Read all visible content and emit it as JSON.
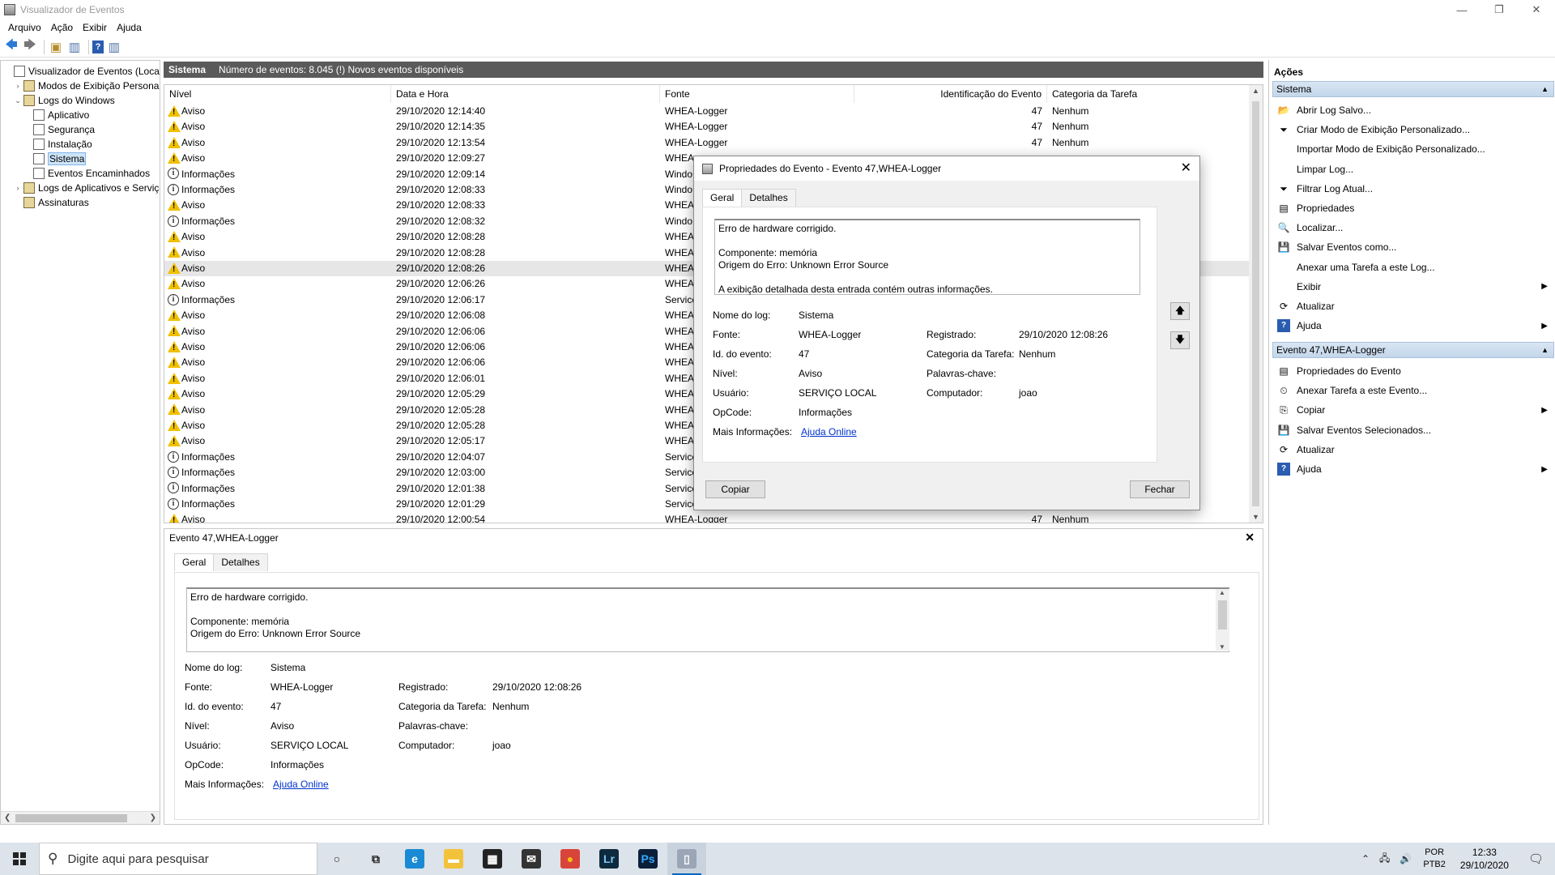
{
  "window": {
    "title": "Visualizador de Eventos",
    "minimize": "—",
    "restore": "❐",
    "close": "✕"
  },
  "menu": [
    "Arquivo",
    "Ação",
    "Exibir",
    "Ajuda"
  ],
  "tree": {
    "items": [
      {
        "label": "Visualizador de Eventos (Local)",
        "level": 0,
        "expander": "",
        "icon": "log"
      },
      {
        "label": "Modos de Exibição Personali",
        "level": 1,
        "expander": "›",
        "icon": "folder"
      },
      {
        "label": "Logs do Windows",
        "level": 1,
        "expander": "⌄",
        "icon": "folder"
      },
      {
        "label": "Aplicativo",
        "level": 2,
        "expander": "",
        "icon": "log"
      },
      {
        "label": "Segurança",
        "level": 2,
        "expander": "",
        "icon": "log"
      },
      {
        "label": "Instalação",
        "level": 2,
        "expander": "",
        "icon": "log"
      },
      {
        "label": "Sistema",
        "level": 2,
        "expander": "",
        "icon": "log",
        "selected": true
      },
      {
        "label": "Eventos Encaminhados",
        "level": 2,
        "expander": "",
        "icon": "log"
      },
      {
        "label": "Logs de Aplicativos e Serviço",
        "level": 1,
        "expander": "›",
        "icon": "folder"
      },
      {
        "label": "Assinaturas",
        "level": 1,
        "expander": "",
        "icon": "folder"
      }
    ]
  },
  "center": {
    "title": "Sistema",
    "count_text": "Número de eventos: 8.045 (!) Novos eventos disponíveis"
  },
  "columns": {
    "level": "Nível",
    "datetime": "Data e Hora",
    "source": "Fonte",
    "event_id": "Identificação do Evento",
    "category": "Categoria da Tarefa"
  },
  "events": [
    {
      "level": "Aviso",
      "type": "warn",
      "datetime": "29/10/2020 12:14:40",
      "source": "WHEA-Logger",
      "id": "47",
      "category": "Nenhum"
    },
    {
      "level": "Aviso",
      "type": "warn",
      "datetime": "29/10/2020 12:14:35",
      "source": "WHEA-Logger",
      "id": "47",
      "category": "Nenhum"
    },
    {
      "level": "Aviso",
      "type": "warn",
      "datetime": "29/10/2020 12:13:54",
      "source": "WHEA-Logger",
      "id": "47",
      "category": "Nenhum"
    },
    {
      "level": "Aviso",
      "type": "warn",
      "datetime": "29/10/2020 12:09:27",
      "source": "WHEA",
      "id": "",
      "category": ""
    },
    {
      "level": "Informações",
      "type": "info",
      "datetime": "29/10/2020 12:09:14",
      "source": "Windo",
      "id": "",
      "category": ""
    },
    {
      "level": "Informações",
      "type": "info",
      "datetime": "29/10/2020 12:08:33",
      "source": "Windo",
      "id": "",
      "category": ""
    },
    {
      "level": "Aviso",
      "type": "warn",
      "datetime": "29/10/2020 12:08:33",
      "source": "WHEA",
      "id": "",
      "category": ""
    },
    {
      "level": "Informações",
      "type": "info",
      "datetime": "29/10/2020 12:08:32",
      "source": "Windo",
      "id": "",
      "category": ""
    },
    {
      "level": "Aviso",
      "type": "warn",
      "datetime": "29/10/2020 12:08:28",
      "source": "WHEA",
      "id": "",
      "category": ""
    },
    {
      "level": "Aviso",
      "type": "warn",
      "datetime": "29/10/2020 12:08:28",
      "source": "WHEA",
      "id": "",
      "category": ""
    },
    {
      "level": "Aviso",
      "type": "warn",
      "datetime": "29/10/2020 12:08:26",
      "source": "WHEA",
      "id": "",
      "category": "",
      "selected": true
    },
    {
      "level": "Aviso",
      "type": "warn",
      "datetime": "29/10/2020 12:06:26",
      "source": "WHEA",
      "id": "",
      "category": ""
    },
    {
      "level": "Informações",
      "type": "info",
      "datetime": "29/10/2020 12:06:17",
      "source": "Service",
      "id": "",
      "category": ""
    },
    {
      "level": "Aviso",
      "type": "warn",
      "datetime": "29/10/2020 12:06:08",
      "source": "WHEA",
      "id": "",
      "category": ""
    },
    {
      "level": "Aviso",
      "type": "warn",
      "datetime": "29/10/2020 12:06:06",
      "source": "WHEA",
      "id": "",
      "category": ""
    },
    {
      "level": "Aviso",
      "type": "warn",
      "datetime": "29/10/2020 12:06:06",
      "source": "WHEA",
      "id": "",
      "category": ""
    },
    {
      "level": "Aviso",
      "type": "warn",
      "datetime": "29/10/2020 12:06:06",
      "source": "WHEA",
      "id": "",
      "category": ""
    },
    {
      "level": "Aviso",
      "type": "warn",
      "datetime": "29/10/2020 12:06:01",
      "source": "WHEA",
      "id": "",
      "category": ""
    },
    {
      "level": "Aviso",
      "type": "warn",
      "datetime": "29/10/2020 12:05:29",
      "source": "WHEA",
      "id": "",
      "category": ""
    },
    {
      "level": "Aviso",
      "type": "warn",
      "datetime": "29/10/2020 12:05:28",
      "source": "WHEA",
      "id": "",
      "category": ""
    },
    {
      "level": "Aviso",
      "type": "warn",
      "datetime": "29/10/2020 12:05:28",
      "source": "WHEA",
      "id": "",
      "category": ""
    },
    {
      "level": "Aviso",
      "type": "warn",
      "datetime": "29/10/2020 12:05:17",
      "source": "WHEA",
      "id": "",
      "category": ""
    },
    {
      "level": "Informações",
      "type": "info",
      "datetime": "29/10/2020 12:04:07",
      "source": "Service",
      "id": "",
      "category": ""
    },
    {
      "level": "Informações",
      "type": "info",
      "datetime": "29/10/2020 12:03:00",
      "source": "Service",
      "id": "",
      "category": ""
    },
    {
      "level": "Informações",
      "type": "info",
      "datetime": "29/10/2020 12:01:38",
      "source": "Service",
      "id": "",
      "category": ""
    },
    {
      "level": "Informações",
      "type": "info",
      "datetime": "29/10/2020 12:01:29",
      "source": "Service",
      "id": "",
      "category": ""
    },
    {
      "level": "Aviso",
      "type": "warn",
      "datetime": "29/10/2020 12:00:54",
      "source": "WHEA-Logger",
      "id": "47",
      "category": "Nenhum"
    }
  ],
  "event_detail": {
    "header": "Evento 47,WHEA-Logger",
    "tabs": [
      "Geral",
      "Detalhes"
    ],
    "description_line1": "Erro de hardware corrigido.",
    "description_line2": "Componente: memória",
    "description_line3": "Origem do Erro: Unknown Error Source",
    "description_line4": "A exibição detalhada desta entrada contém outras informações.",
    "labels": {
      "log_name": "Nome do log:",
      "source": "Fonte:",
      "event_id": "Id. do evento:",
      "level": "Nível:",
      "user": "Usuário:",
      "opcode": "OpCode:",
      "more_info": "Mais Informações:",
      "logged": "Registrado:",
      "task_category": "Categoria da Tarefa:",
      "keywords": "Palavras-chave:",
      "computer": "Computador:"
    },
    "values": {
      "log_name": "Sistema",
      "source": "WHEA-Logger",
      "event_id": "47",
      "level": "Aviso",
      "user": "SERVIÇO LOCAL",
      "opcode": "Informações",
      "more_info": "Ajuda Online",
      "logged": "29/10/2020 12:08:26",
      "task_category": "Nenhum",
      "keywords": "",
      "computer": "joao"
    }
  },
  "dialog": {
    "title": "Propriedades do Evento - Evento 47,WHEA-Logger",
    "copy_button": "Copiar",
    "close_button": "Fechar"
  },
  "actions": {
    "title": "Ações",
    "section1": "Sistema",
    "section1_items": [
      {
        "label": "Abrir Log Salvo...",
        "icon": "📂"
      },
      {
        "label": "Criar Modo de Exibição Personalizado...",
        "icon": "⏷"
      },
      {
        "label": "Importar Modo de Exibição Personalizado...",
        "icon": ""
      },
      {
        "label": "Limpar Log...",
        "icon": ""
      },
      {
        "label": "Filtrar Log Atual...",
        "icon": "⏷"
      },
      {
        "label": "Propriedades",
        "icon": "▤"
      },
      {
        "label": "Localizar...",
        "icon": "🔍"
      },
      {
        "label": "Salvar Eventos como...",
        "icon": "💾"
      },
      {
        "label": "Anexar uma Tarefa a este Log...",
        "icon": ""
      },
      {
        "label": "Exibir",
        "icon": "",
        "submenu": true
      },
      {
        "label": "Atualizar",
        "icon": "⟳"
      },
      {
        "label": "Ajuda",
        "icon": "?",
        "submenu": true
      }
    ],
    "section2": "Evento 47,WHEA-Logger",
    "section2_items": [
      {
        "label": "Propriedades do Evento",
        "icon": "▤"
      },
      {
        "label": "Anexar Tarefa a este Evento...",
        "icon": "⏲"
      },
      {
        "label": "Copiar",
        "icon": "⎘",
        "submenu": true
      },
      {
        "label": "Salvar Eventos Selecionados...",
        "icon": "💾"
      },
      {
        "label": "Atualizar",
        "icon": "⟳"
      },
      {
        "label": "Ajuda",
        "icon": "?",
        "submenu": true
      }
    ]
  },
  "taskbar": {
    "search_placeholder": "Digite aqui para pesquisar",
    "apps": [
      {
        "name": "cortana-icon",
        "glyph": "○",
        "bg": "transparent",
        "color": "#222"
      },
      {
        "name": "task-view-icon",
        "glyph": "⧉",
        "bg": "transparent",
        "color": "#222"
      },
      {
        "name": "edge-icon",
        "glyph": "e",
        "bg": "#1a8ad4",
        "color": "#fff"
      },
      {
        "name": "file-explorer-icon",
        "glyph": "▬",
        "bg": "#f2c23a",
        "color": "#fff"
      },
      {
        "name": "store-icon",
        "glyph": "▦",
        "bg": "#222",
        "color": "#fff"
      },
      {
        "name": "mail-icon",
        "glyph": "✉",
        "bg": "#333",
        "color": "#fff"
      },
      {
        "name": "chrome-icon",
        "glyph": "●",
        "bg": "#d9443a",
        "color": "#f4c20d"
      },
      {
        "name": "lightroom-icon",
        "glyph": "Lr",
        "bg": "#0e2a3e",
        "color": "#7cc6f6"
      },
      {
        "name": "photoshop-icon",
        "glyph": "Ps",
        "bg": "#0b1f3a",
        "color": "#31a8ff"
      },
      {
        "name": "event-viewer-icon",
        "glyph": "▯",
        "bg": "#9aa6b6",
        "color": "#fff",
        "active": true
      }
    ],
    "language_line1": "POR",
    "language_line2": "PTB2",
    "time": "12:33",
    "date": "29/10/2020"
  }
}
